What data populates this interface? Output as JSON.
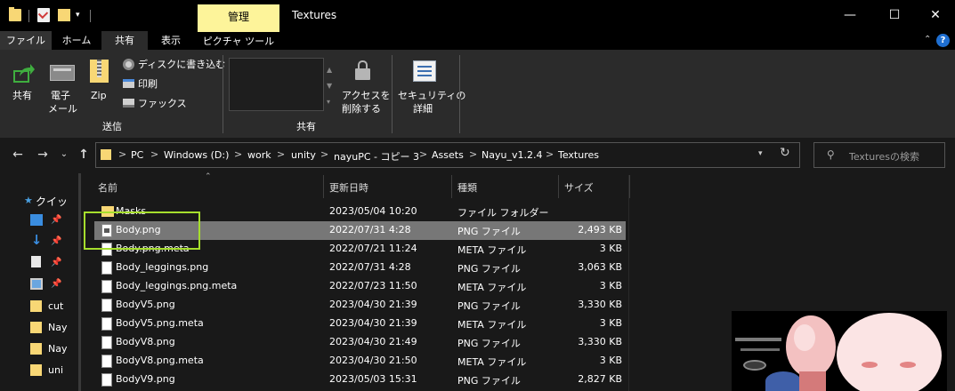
{
  "window": {
    "title": "Textures",
    "context_tab": "管理",
    "minimize_glyph": "—",
    "maximize_glyph": "☐",
    "close_glyph": "✕",
    "qa_dropdown_glyph": "▾"
  },
  "tabs": [
    {
      "label": "ファイル"
    },
    {
      "label": "ホーム"
    },
    {
      "label": "共有"
    },
    {
      "label": "表示"
    },
    {
      "label": "ピクチャ ツール"
    }
  ],
  "ribbon": {
    "share_label": "共有",
    "email_label_1": "電子",
    "email_label_2": "メール",
    "zip_label": "Zip",
    "burn_label": "ディスクに書き込む",
    "print_label": "印刷",
    "fax_label": "ファックス",
    "send_group": "送信",
    "remove_access_1": "アクセスを",
    "remove_access_2": "削除する",
    "security_1": "セキュリティの",
    "security_2": "詳細",
    "share_group": "共有",
    "help_glyph": "?",
    "collapse_glyph": "⌃"
  },
  "address": {
    "crumbs": [
      "PC",
      "Windows (D:)",
      "work",
      "unity",
      "nayuPC - コピー 3",
      "Assets",
      "Nayu_v1.2.4",
      "Textures"
    ],
    "separator": ">",
    "search_placeholder": "Texturesの検索"
  },
  "nav": {
    "back_glyph": "←",
    "forward_glyph": "→",
    "recent_glyph": "⌄",
    "up_glyph": "↑",
    "refresh_glyph": "↻",
    "quick_access": "クイッ",
    "items": [
      "cut",
      "Nay",
      "Nay",
      "uni"
    ]
  },
  "columns": {
    "name": "名前",
    "date": "更新日時",
    "type": "種類",
    "size": "サイズ"
  },
  "files": [
    {
      "name": "Masks",
      "date": "2023/05/04 10:20",
      "type": "ファイル フォルダー",
      "size": "",
      "icon": "folder"
    },
    {
      "name": "Body.png",
      "date": "2022/07/31 4:28",
      "type": "PNG ファイル",
      "size": "2,493 KB",
      "icon": "image",
      "selected": true
    },
    {
      "name": "Body.png.meta",
      "date": "2022/07/21 11:24",
      "type": "META ファイル",
      "size": "3 KB",
      "icon": "file"
    },
    {
      "name": "Body_leggings.png",
      "date": "2022/07/31 4:28",
      "type": "PNG ファイル",
      "size": "3,063 KB",
      "icon": "file"
    },
    {
      "name": "Body_leggings.png.meta",
      "date": "2022/07/23 11:50",
      "type": "META ファイル",
      "size": "3 KB",
      "icon": "file"
    },
    {
      "name": "BodyV5.png",
      "date": "2023/04/30 21:39",
      "type": "PNG ファイル",
      "size": "3,330 KB",
      "icon": "file"
    },
    {
      "name": "BodyV5.png.meta",
      "date": "2023/04/30 21:39",
      "type": "META ファイル",
      "size": "3 KB",
      "icon": "file"
    },
    {
      "name": "BodyV8.png",
      "date": "2023/04/30 21:49",
      "type": "PNG ファイル",
      "size": "3,330 KB",
      "icon": "file"
    },
    {
      "name": "BodyV8.png.meta",
      "date": "2023/04/30 21:50",
      "type": "META ファイル",
      "size": "3 KB",
      "icon": "file"
    },
    {
      "name": "BodyV9.png",
      "date": "2023/05/03 15:31",
      "type": "PNG ファイル",
      "size": "2,827 KB",
      "icon": "file"
    }
  ],
  "colors": {
    "highlight": "#a6de2d",
    "context_tab": "#fdf49a",
    "selection": "#777777",
    "folder": "#f8d775"
  }
}
